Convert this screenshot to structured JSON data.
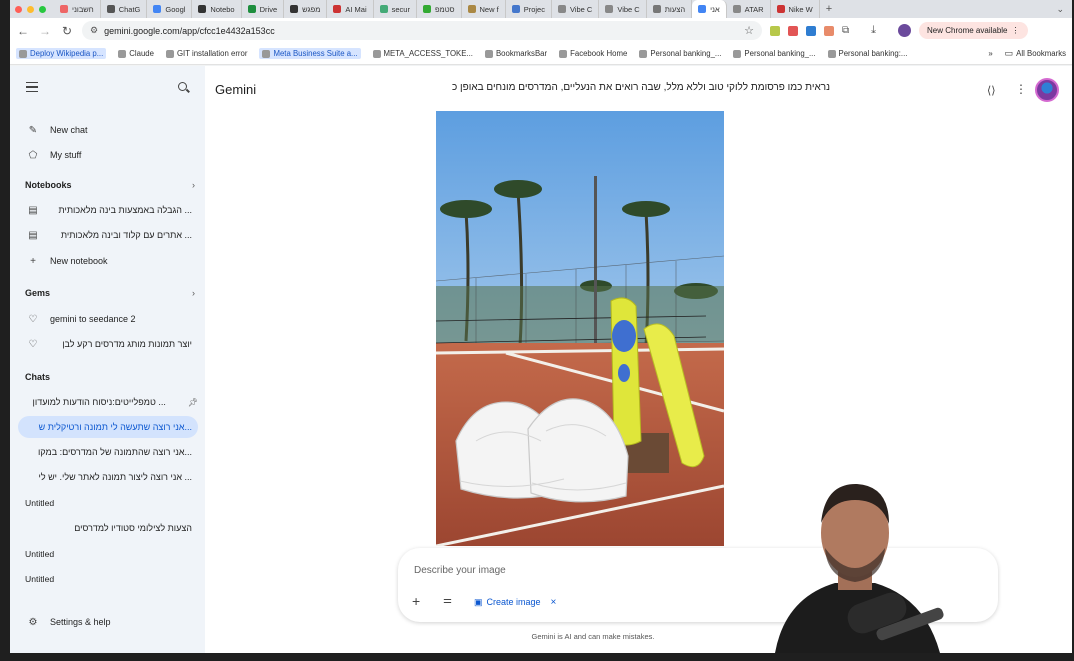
{
  "tabs": [
    {
      "label": "חשבוני",
      "color": "#e66"
    },
    {
      "label": "ChatG",
      "color": "#555"
    },
    {
      "label": "Googl",
      "color": "#4285f4"
    },
    {
      "label": "Notebo",
      "color": "#333"
    },
    {
      "label": "Drive",
      "color": "#1e8e3e"
    },
    {
      "label": "מפגש",
      "color": "#333"
    },
    {
      "label": "AI Mai",
      "color": "#c33"
    },
    {
      "label": "secur",
      "color": "#4a7"
    },
    {
      "label": "סטמפ",
      "color": "#3a3"
    },
    {
      "label": "New f",
      "color": "#a84"
    },
    {
      "label": "Projec",
      "color": "#47c"
    },
    {
      "label": "Vibe C",
      "color": "#888"
    },
    {
      "label": "Vibe C",
      "color": "#888"
    },
    {
      "label": "הצעות",
      "color": "#777"
    },
    {
      "label": "אני",
      "color": "#4285f4",
      "active": true
    },
    {
      "label": "ATAR",
      "color": "#888"
    },
    {
      "label": "Nike W",
      "color": "#c33"
    }
  ],
  "toolbar": {
    "url": "gemini.google.com/app/cfcc1e4432a153cc",
    "new_chrome_label": "New Chrome available"
  },
  "bookmarks": [
    {
      "label": "Deploy Wikipedia p...",
      "highlight": true
    },
    {
      "label": "Claude"
    },
    {
      "label": "GIT installation error"
    },
    {
      "label": "Meta Business Suite a...",
      "highlight": true
    },
    {
      "label": "META_ACCESS_TOKE..."
    },
    {
      "label": "BookmarksBar"
    },
    {
      "label": "Facebook  Home"
    },
    {
      "label": "Personal banking_..."
    },
    {
      "label": "Personal banking_..."
    },
    {
      "label": "Personal banking:..."
    }
  ],
  "bookmarks_more": "»",
  "bookmarks_all": "All Bookmarks",
  "sidebar": {
    "new_chat": "New chat",
    "my_stuff": "My stuff",
    "notebooks_header": "Notebooks",
    "notebooks": [
      "הגבלה באמצעות בינה מלאכותית ...",
      "אתרים עם קלוד ובינה מלאכותית ..."
    ],
    "new_notebook": "New notebook",
    "gems_header": "Gems",
    "gems": [
      "gemini to seedance 2",
      "יוצר תמונות מותג מדרסים רקע לבן"
    ],
    "chats_header": "Chats",
    "chats": [
      {
        "label": "טמפלייטים:ניסוח הודעות למועדון ...",
        "pinned": true
      },
      {
        "label": "אני רוצה שתעשה לי תמונה ורטיקלית ש...",
        "active": true
      },
      {
        "label": "אני רוצה שהתמונה של המדרסים: במקו..."
      },
      {
        "label": "אני רוצה ליצור תמונה לאתר שלי. יש לי ..."
      }
    ],
    "untitled_1": "Untitled",
    "chat_after_untitled": "הצעות לצילומי סטודיו למדרסים",
    "untitled_2": "Untitled",
    "untitled_3": "Untitled",
    "settings": "Settings & help"
  },
  "main": {
    "brand": "Gemini",
    "conversation_title": "נראית כמו פרסומת ללוקי טוב וללא מלל, שבה רואים את הנעליים, המדרסים מונחים באופן כ",
    "prompt_placeholder": "Describe your image",
    "create_image_label": "Create image",
    "disclaimer": "Gemini is AI and can make mistakes."
  },
  "colors": {
    "sidebar_bg": "#f0f4f9",
    "active_chat_bg": "#d3e3fd",
    "accent": "#0b57d0",
    "court": "#b5543a",
    "insole": "#e4e83a"
  }
}
